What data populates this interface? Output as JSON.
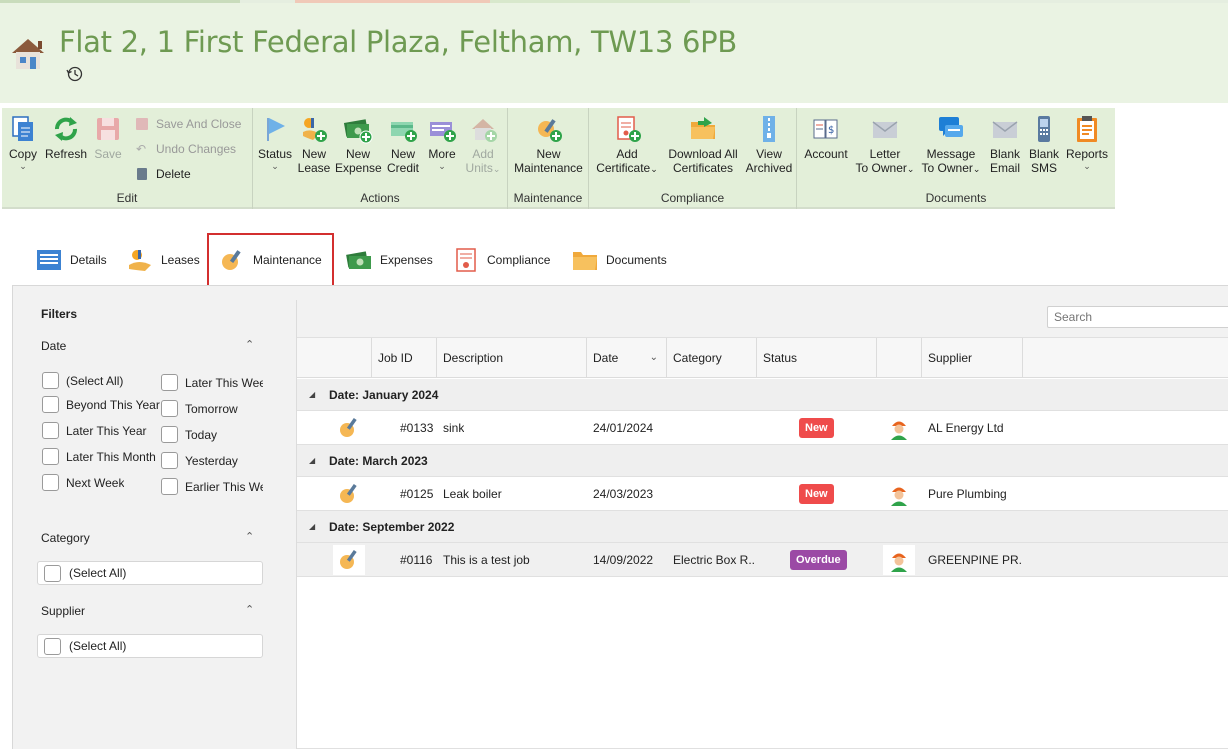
{
  "header": {
    "title": "Flat 2, 1 First Federal Plaza, Feltham, TW13 6PB",
    "icon": "house-icon",
    "history_icon": "history-icon"
  },
  "ribbon": {
    "groups": {
      "edit": "Edit",
      "actions": "Actions",
      "maintenance": "Maintenance",
      "compliance": "Compliance",
      "documents": "Documents"
    },
    "copy": "Copy",
    "refresh": "Refresh",
    "save": "Save",
    "save_and_close": "Save And Close",
    "undo_changes": "Undo Changes",
    "delete": "Delete",
    "status": "Status",
    "new_lease": [
      "New",
      "Lease"
    ],
    "new_expense": [
      "New",
      "Expense"
    ],
    "new_credit": [
      "New",
      "Credit"
    ],
    "more": "More",
    "add_units": [
      "Add",
      "Units"
    ],
    "new_maintenance": [
      "New",
      "Maintenance"
    ],
    "add_certificate": [
      "Add",
      "Certificate"
    ],
    "download_all_certificates": [
      "Download All",
      "Certificates"
    ],
    "view_archived": [
      "View",
      "Archived"
    ],
    "account": "Account",
    "letter_to_owner": [
      "Letter",
      "To Owner"
    ],
    "message_to_owner": [
      "Message",
      "To Owner"
    ],
    "blank_email": [
      "Blank",
      "Email"
    ],
    "blank_sms": [
      "Blank",
      "SMS"
    ],
    "reports": "Reports"
  },
  "tabs": [
    {
      "label": "Details",
      "icon": "details-icon"
    },
    {
      "label": "Leases",
      "icon": "leases-icon"
    },
    {
      "label": "Maintenance",
      "icon": "maintenance-icon",
      "active": true
    },
    {
      "label": "Expenses",
      "icon": "expenses-icon"
    },
    {
      "label": "Compliance",
      "icon": "compliance-icon"
    },
    {
      "label": "Documents",
      "icon": "documents-icon"
    }
  ],
  "filters": {
    "title": "Filters",
    "date": {
      "label": "Date",
      "left": [
        "(Select All)",
        "Beyond This Year",
        "Later This Year",
        "Later This Month",
        "Next Week"
      ],
      "right": [
        "Later This Wee",
        "Tomorrow",
        "Today",
        "Yesterday",
        "Earlier This We"
      ]
    },
    "category": {
      "label": "Category",
      "select_all": "(Select All)"
    },
    "supplier": {
      "label": "Supplier",
      "select_all": "(Select All)"
    }
  },
  "grid": {
    "search_placeholder": "Search",
    "columns": [
      "Job ID",
      "Description",
      "Date",
      "Category",
      "Status",
      "Supplier"
    ],
    "groups": [
      {
        "label": "Date: January 2024",
        "rows": [
          {
            "job_id": "#0133",
            "description": "sink",
            "date": "24/01/2024",
            "category": "",
            "status": "New",
            "supplier": "AL Energy Ltd"
          }
        ]
      },
      {
        "label": "Date: March 2023",
        "rows": [
          {
            "job_id": "#0125",
            "description": "Leak boiler",
            "date": "24/03/2023",
            "category": "",
            "status": "New",
            "supplier": "Pure Plumbing"
          }
        ]
      },
      {
        "label": "Date: September 2022",
        "rows": [
          {
            "job_id": "#0116",
            "description": "This is a test job",
            "date": "14/09/2022",
            "category": "Electric Box R...",
            "status": "Overdue",
            "supplier": "GREENPINE PR..."
          }
        ]
      }
    ]
  },
  "colors": {
    "title_green": "#6e9a52",
    "ribbon_bg": "#e3efd9",
    "header_bg": "#eaf3e3",
    "status_new": "#ef4b4b",
    "status_overdue": "#9b4aa5",
    "active_tab_border": "#d32f2f"
  }
}
